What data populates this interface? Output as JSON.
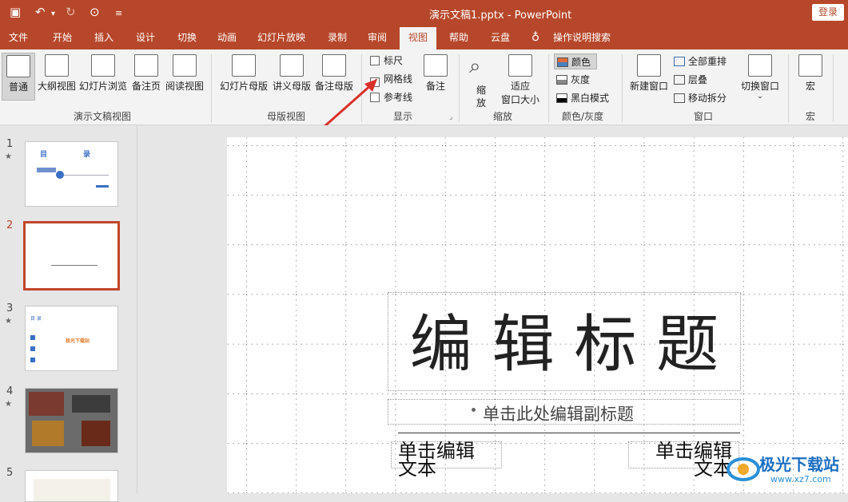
{
  "titlebar": {
    "doc_title": "演示文稿1.pptx  -  PowerPoint",
    "signin": "登录"
  },
  "tabs": [
    "文件",
    "开始",
    "插入",
    "设计",
    "切换",
    "动画",
    "幻灯片放映",
    "录制",
    "审阅",
    "视图",
    "帮助",
    "云盘",
    "操作说明搜索"
  ],
  "active_tab": "视图",
  "ribbon": {
    "presentation_views": {
      "label": "演示文稿视图",
      "buttons": [
        "普通",
        "大纲视图",
        "幻灯片浏览",
        "备注页",
        "阅读视图"
      ]
    },
    "master_views": {
      "label": "母版视图",
      "buttons": [
        "幻灯片母版",
        "讲义母版",
        "备注母版"
      ]
    },
    "show": {
      "label": "显示",
      "ruler": "标尺",
      "gridlines": "网格线",
      "guides": "参考线",
      "notes": "备注",
      "gridlines_checked": true
    },
    "zoom": {
      "label": "缩放",
      "zoom_btn_l1": "缩",
      "zoom_btn_l2": "放",
      "fit_l1": "适应",
      "fit_l2": "窗口大小"
    },
    "color": {
      "label": "颜色/灰度",
      "color": "颜色",
      "grayscale": "灰度",
      "bw": "黑白模式"
    },
    "window": {
      "label": "窗口",
      "new_window": "新建窗口",
      "arrange_all": "全部重排",
      "cascade": "层叠",
      "move_split": "移动拆分",
      "switch_windows": "切换窗口"
    },
    "macros": {
      "label": "宏",
      "macro": "宏"
    }
  },
  "thumbnails": [
    {
      "num": "1",
      "star": "★"
    },
    {
      "num": "2",
      "star": ""
    },
    {
      "num": "3",
      "star": "★"
    },
    {
      "num": "4",
      "star": "★"
    },
    {
      "num": "5",
      "star": ""
    }
  ],
  "thumb_text": {
    "t1_title_a": "目",
    "t1_title_b": "录",
    "t3_title": "目 录",
    "t3_orange": "极光下载站"
  },
  "slide": {
    "title": "编 辑 标 题",
    "subtitle": "单击此处编辑副标题",
    "left_text_1": "单击编辑",
    "left_text_2": "文本",
    "right_text_1": "单击编辑",
    "right_text_2": "文本"
  },
  "watermark": {
    "name": "极光下载站",
    "url": "www.xz7.com"
  },
  "colors": {
    "accent": "#b7472a",
    "ribbon_bg": "#f3f3f3",
    "arrow": "#d9302a"
  }
}
